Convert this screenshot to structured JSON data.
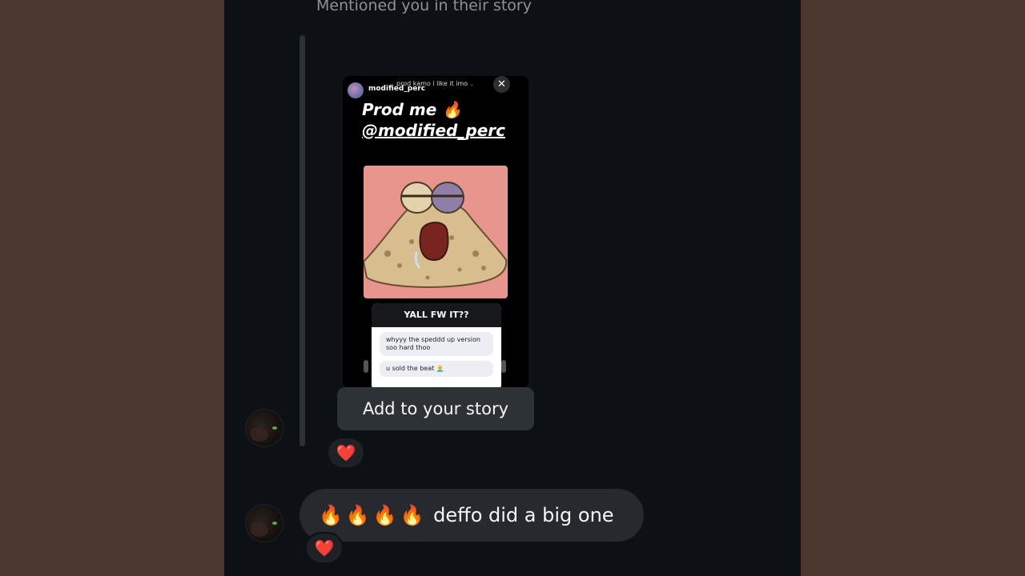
{
  "thread": {
    "mention_text": "Mentioned you in their story"
  },
  "story": {
    "username": "modified_perc",
    "song": "prod kamo i like it imo",
    "headline": "Prod me 🔥",
    "mention": "@modified_perc",
    "question": "YALL FW IT??",
    "answers": [
      "whyyy the speddd up version soo hard thoo",
      "u sold the beat 👨‍🦲"
    ]
  },
  "actions": {
    "add_to_story": "Add to your story"
  },
  "reactions": {
    "story_reaction": "❤️",
    "message_reaction": "❤️"
  },
  "message": {
    "emoji": "🔥🔥🔥🔥",
    "text": "deffo did a big one"
  },
  "colors": {
    "background_frame": "#4a372d",
    "screen": "#0d1014",
    "bubble": "#262a2e",
    "heart": "#e02a3a"
  }
}
